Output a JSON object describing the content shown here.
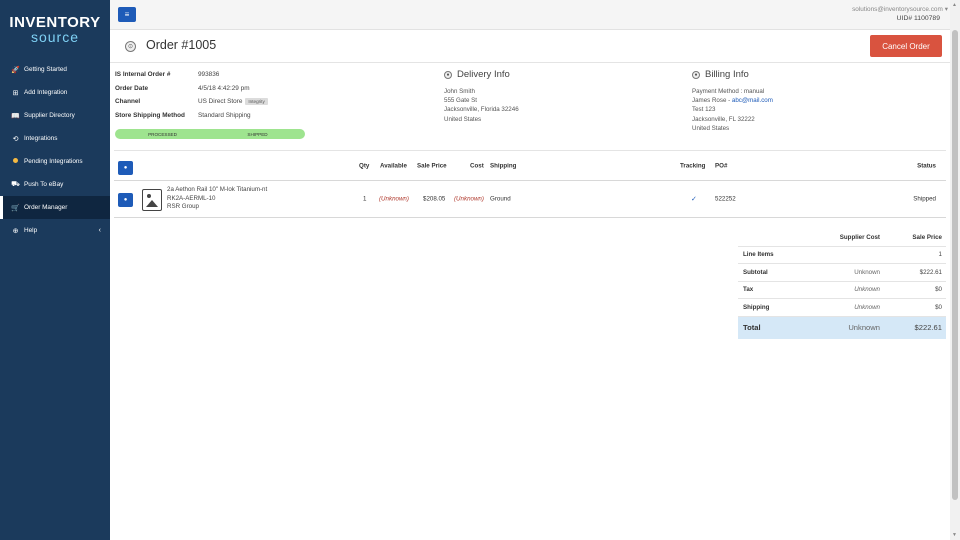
{
  "brand": {
    "top": "INVENTORY",
    "bottom": "source"
  },
  "sidebar": {
    "items": [
      {
        "label": "Getting Started",
        "icon": "rocket-icon",
        "glyph": "🚀"
      },
      {
        "label": "Add Integration",
        "icon": "add-icon",
        "glyph": "⊞"
      },
      {
        "label": "Supplier Directory",
        "icon": "book-icon",
        "glyph": "📖"
      },
      {
        "label": "Integrations",
        "icon": "sync-icon",
        "glyph": "⟲"
      },
      {
        "label": "Pending Integrations",
        "icon": "pending-dot-icon",
        "glyph": ""
      },
      {
        "label": "Push To eBay",
        "icon": "push-icon",
        "glyph": "⛟"
      },
      {
        "label": "Order Manager",
        "icon": "cart-icon",
        "glyph": "🛒"
      },
      {
        "label": "Help",
        "icon": "help-icon",
        "glyph": "⊕"
      }
    ],
    "help_caret": "‹"
  },
  "topbar": {
    "menu_glyph": "≡",
    "email": "solutions@inventorysource.com",
    "uid": "UID# 1100789"
  },
  "header": {
    "back_glyph": "⊙",
    "title": "Order #1005",
    "cancel_label": "Cancel Order"
  },
  "order": {
    "rows": [
      {
        "label": "IS Internal Order #",
        "value": "993836"
      },
      {
        "label": "Order Date",
        "value": "4/5/18 4:42:29 pm"
      },
      {
        "label": "Channel",
        "value": "US Direct Store",
        "badge": "Integrity"
      },
      {
        "label": "Store Shipping Method",
        "value": "Standard Shipping"
      }
    ],
    "progress": [
      "PROCESSED",
      "SHIPPED"
    ]
  },
  "delivery": {
    "title": "Delivery Info",
    "lines": [
      "John Smith",
      "555 Gate St",
      "Jacksonville, Florida 32246",
      "United States"
    ]
  },
  "billing": {
    "title": "Billing Info",
    "payment": "Payment Method : manual",
    "name": "James Rose - ",
    "email": "abc@mail.com",
    "lines": [
      "Test 123",
      "Jacksonville, FL 32222",
      "United States"
    ]
  },
  "line_items": {
    "headers": {
      "qty": "Qty",
      "available": "Available",
      "sale_price": "Sale Price",
      "cost": "Cost",
      "shipping": "Shipping",
      "tracking": "Tracking",
      "po": "PO#",
      "status": "Status"
    },
    "rows": [
      {
        "title": "2a Aethon Rail 10\" M-lok Titanium-nt",
        "sku": "RK2A-AERML-10",
        "supplier": "RSR Group",
        "qty": "1",
        "available": "(Unknown)",
        "sale_price": "$208.05",
        "cost": "(Unknown)",
        "shipping": "Ground",
        "tracking": "✓",
        "po": "522252",
        "status": "Shipped"
      }
    ]
  },
  "totals": {
    "headers": {
      "supplier_cost": "Supplier Cost",
      "sale_price": "Sale Price"
    },
    "rows": [
      {
        "label": "Line Items",
        "cost": "",
        "price": "1"
      },
      {
        "label": "Subtotal",
        "cost": "Unknown",
        "price": "$222.61"
      },
      {
        "label": "Tax",
        "cost": "Unknown",
        "price": "$0"
      },
      {
        "label": "Shipping",
        "cost": "Unknown",
        "price": "$0"
      }
    ],
    "total": {
      "label": "Total",
      "cost": "Unknown",
      "price": "$222.61"
    }
  }
}
